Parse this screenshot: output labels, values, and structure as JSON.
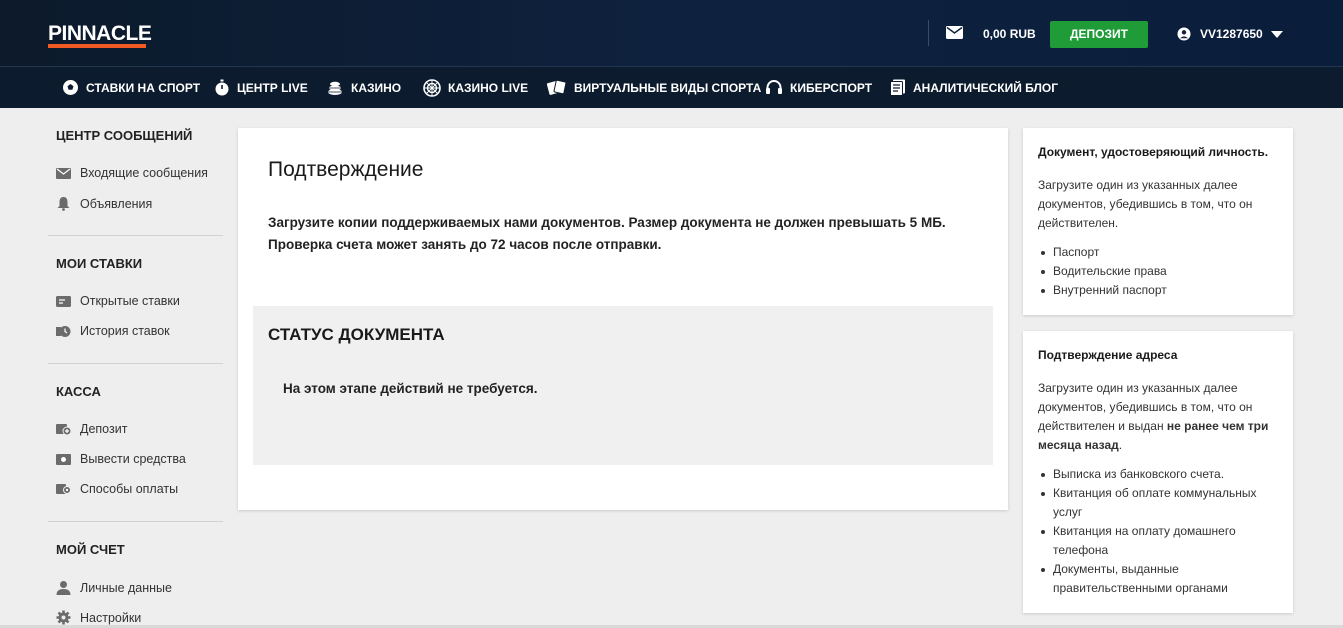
{
  "header": {
    "logo": "PINNACLE",
    "balance": "0,00 RUB",
    "deposit_label": "ДЕПОЗИТ",
    "username": "VV1287650",
    "brand_color": "#f15a22",
    "deposit_color": "#1f9c38"
  },
  "nav": [
    {
      "label": "СТАВКИ НА СПОРТ",
      "icon": "soccer-ball-icon"
    },
    {
      "label": "ЦЕНТР LIVE",
      "icon": "stopwatch-icon"
    },
    {
      "label": "КАЗИНО",
      "icon": "casino-chips-icon"
    },
    {
      "label": "КАЗИНО LIVE",
      "icon": "roulette-icon"
    },
    {
      "label": "ВИРТУАЛЬНЫЕ ВИДЫ СПОРТА",
      "icon": "cards-icon"
    },
    {
      "label": "КИБЕРСПОРТ",
      "icon": "headset-icon"
    },
    {
      "label": "АНАЛИТИЧЕСКИЙ БЛОГ",
      "icon": "document-icon"
    }
  ],
  "sidebar": {
    "sections": [
      {
        "title": "ЦЕНТР СООБЩЕНИЙ",
        "items": [
          {
            "label": "Входящие сообщения",
            "icon": "envelope-icon"
          },
          {
            "label": "Объявления",
            "icon": "bell-icon"
          }
        ]
      },
      {
        "title": "МОИ СТАВКИ",
        "items": [
          {
            "label": "Открытые ставки",
            "icon": "ticket-icon"
          },
          {
            "label": "История ставок",
            "icon": "history-icon"
          }
        ]
      },
      {
        "title": "КАССА",
        "items": [
          {
            "label": "Депозит",
            "icon": "deposit-icon"
          },
          {
            "label": "Вывести средства",
            "icon": "withdraw-icon"
          },
          {
            "label": "Способы оплаты",
            "icon": "payment-methods-icon"
          }
        ]
      },
      {
        "title": "МОЙ СЧЕТ",
        "items": [
          {
            "label": "Личные данные",
            "icon": "person-icon"
          },
          {
            "label": "Настройки",
            "icon": "gear-icon"
          }
        ]
      }
    ]
  },
  "main": {
    "title": "Подтверждение",
    "line1": "Загрузите копии поддерживаемых нами документов. Размер документа не должен превышать 5 МБ.",
    "line2": "Проверка счета может занять до 72 часов после отправки.",
    "status_title": "СТАТУС ДОКУМЕНТА",
    "status_text": "На этом этапе действий не требуется."
  },
  "info_id": {
    "title": "Документ, удостоверяющий личность.",
    "text": "Загрузите один из указанных далее документов, убедившись в том, что он действителен.",
    "items": [
      "Паспорт",
      "Водительские права",
      "Внутренний паспорт"
    ]
  },
  "info_address": {
    "title": "Подтверждение адреса",
    "text_before": "Загрузите один из указанных далее документов, убедившись в том, что он действителен и выдан ",
    "text_bold": "не ранее чем три месяца назад",
    "text_after": ".",
    "items": [
      "Выписка из банковского счета.",
      "Квитанция об оплате коммунальных услуг",
      "Квитанция на оплату домашнего телефона",
      "Документы, выданные правительственными органами"
    ]
  }
}
